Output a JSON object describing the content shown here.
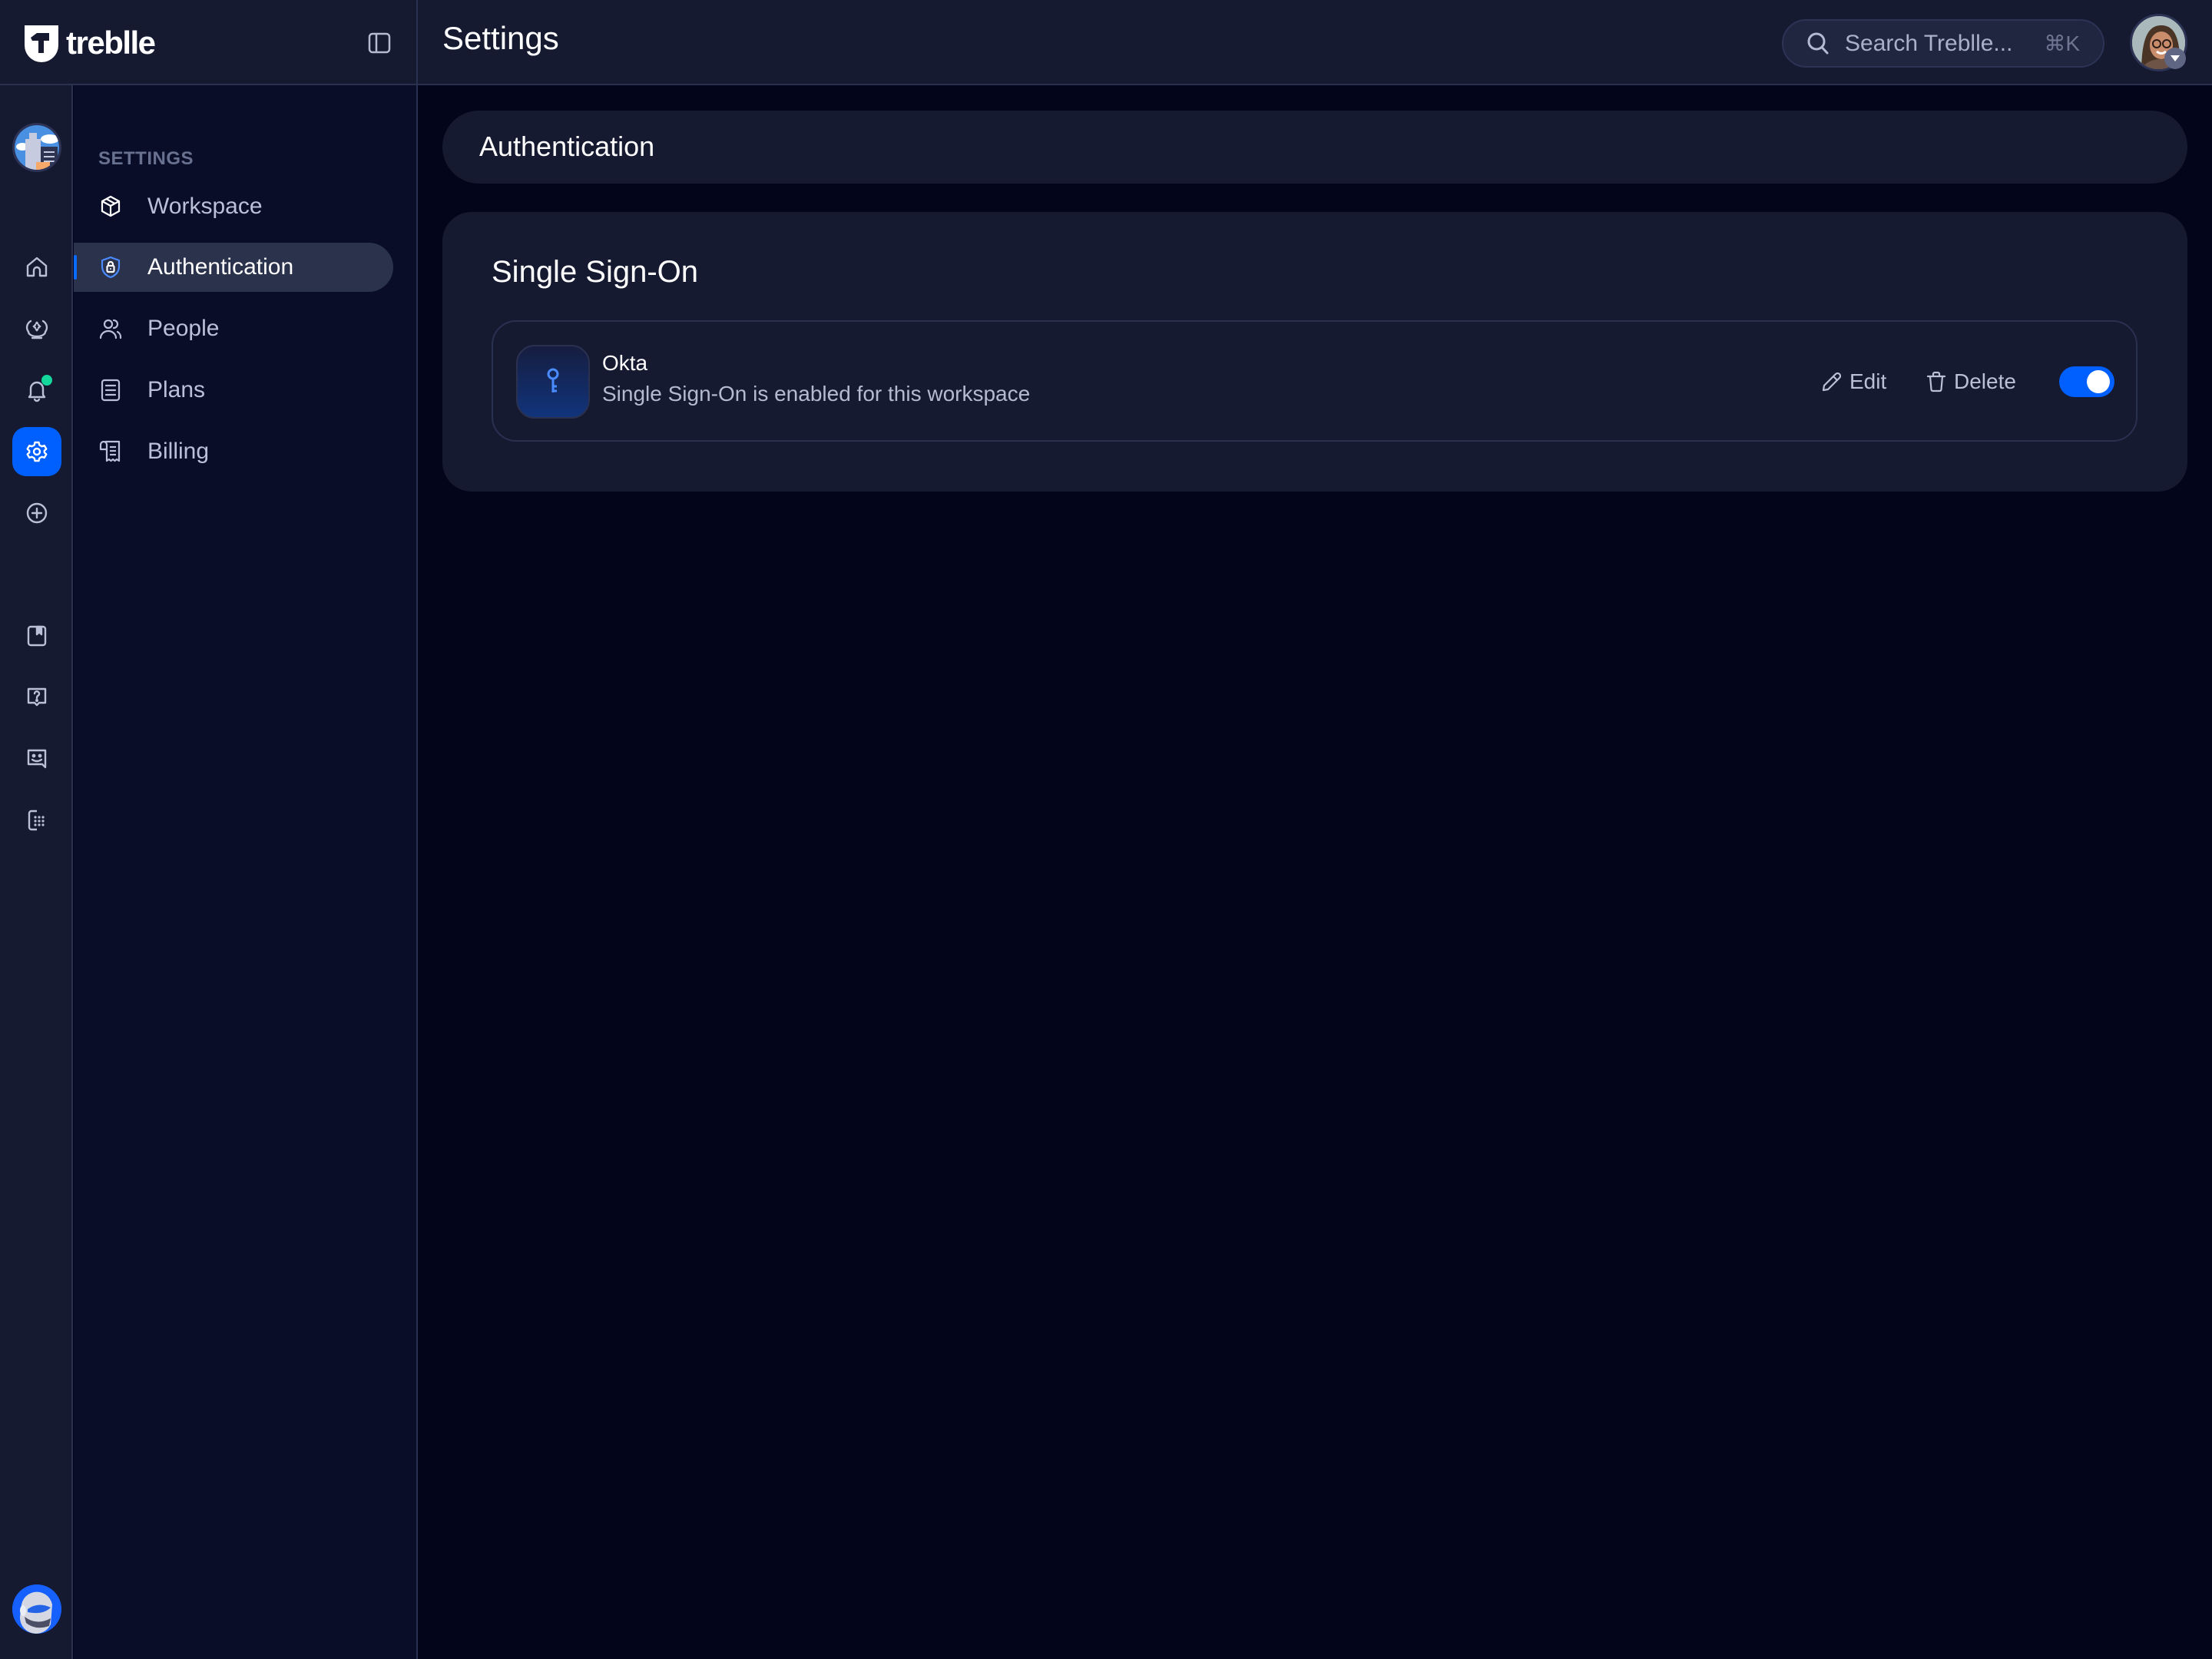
{
  "app": {
    "brand_name": "treblle",
    "page_title": "Settings"
  },
  "search": {
    "placeholder": "Search Treblle...",
    "shortcut": "⌘K"
  },
  "rail": {
    "items": [
      {
        "id": "home",
        "icon": "home-icon"
      },
      {
        "id": "api-monitor",
        "icon": "monitor-icon"
      },
      {
        "id": "notifications",
        "icon": "bell-icon",
        "has_notification": true
      },
      {
        "id": "settings",
        "icon": "gear-icon",
        "active": true
      },
      {
        "id": "add",
        "icon": "plus-circle-icon"
      },
      {
        "id": "docs",
        "icon": "bookmark-icon"
      },
      {
        "id": "help",
        "icon": "help-bubble-icon"
      },
      {
        "id": "feedback",
        "icon": "chat-smile-icon"
      },
      {
        "id": "apps",
        "icon": "dialpad-icon"
      }
    ]
  },
  "sidebar": {
    "section_label": "SETTINGS",
    "items": [
      {
        "label": "Workspace",
        "icon": "cube-icon",
        "active": false
      },
      {
        "label": "Authentication",
        "icon": "shield-lock-icon",
        "active": true
      },
      {
        "label": "People",
        "icon": "users-icon",
        "active": false
      },
      {
        "label": "Plans",
        "icon": "document-list-icon",
        "active": false
      },
      {
        "label": "Billing",
        "icon": "receipt-icon",
        "active": false
      }
    ]
  },
  "main": {
    "section_title": "Authentication",
    "sso_card": {
      "title": "Single Sign-On",
      "provider": {
        "name": "Okta",
        "description": "Single Sign-On is enabled for this workspace",
        "icon": "key-icon",
        "enabled": true
      },
      "edit_label": "Edit",
      "delete_label": "Delete"
    }
  },
  "colors": {
    "accent": "#0060ff",
    "notification": "#14d79b",
    "background": "#03061a",
    "panel": "#151a31"
  }
}
